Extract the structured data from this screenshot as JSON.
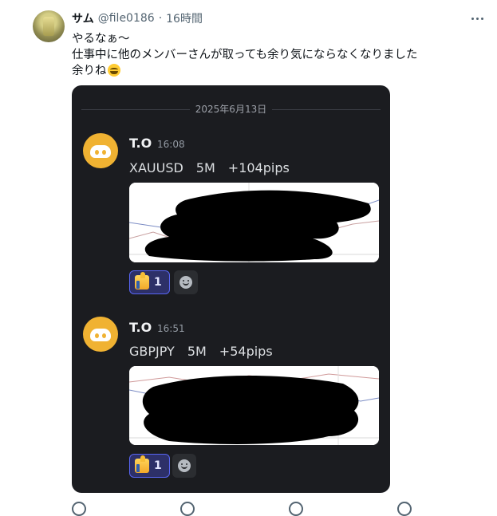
{
  "tweet": {
    "display_name": "サム",
    "handle": "@file0186",
    "separator": "·",
    "time_ago": "16時間",
    "lines": [
      "やるなぁ～",
      "仕事中に他のメンバーさんが取っても余り気にならなくなりました",
      "余りね"
    ]
  },
  "media": {
    "date_divider": "2025年6月13日",
    "messages": [
      {
        "author": "T.O",
        "time": "16:08",
        "text": "XAUUSD　5M　+104pips",
        "reaction_count": "1"
      },
      {
        "author": "T.O",
        "time": "16:51",
        "text": "GBPJPY　5M　+54pips",
        "reaction_count": "1"
      }
    ]
  },
  "colors": {
    "discord_bg": "#1b1c20",
    "discord_avatar": "#f0b232",
    "reaction_bg": "#2d3068",
    "reaction_border": "#5865f2"
  }
}
